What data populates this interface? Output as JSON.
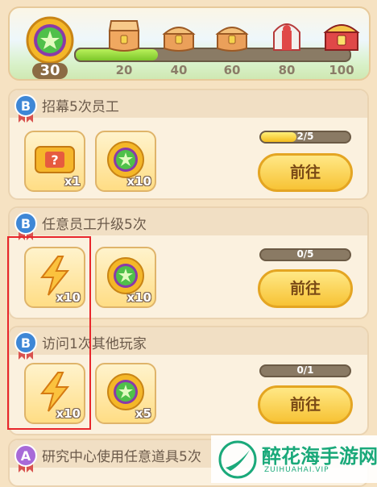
{
  "progress": {
    "current_points": "30",
    "current_value": 30,
    "max_value": 100,
    "milestones": [
      "20",
      "40",
      "60",
      "80",
      "100"
    ]
  },
  "tasks": [
    {
      "grade": "B",
      "title": "招幕5次员工",
      "rewards": [
        {
          "icon": "ticket-icon",
          "qty": "x1"
        },
        {
          "icon": "star-coin-icon",
          "qty": "x10"
        }
      ],
      "progress_text": "2/5",
      "progress_fraction": 0.4,
      "button": "前往"
    },
    {
      "grade": "B",
      "title": "任意员工升级5次",
      "rewards": [
        {
          "icon": "lightning-icon",
          "qty": "x10"
        },
        {
          "icon": "star-coin-icon",
          "qty": "x10"
        }
      ],
      "progress_text": "0/5",
      "progress_fraction": 0,
      "button": "前往"
    },
    {
      "grade": "B",
      "title": "访问1次其他玩家",
      "rewards": [
        {
          "icon": "lightning-icon",
          "qty": "x10"
        },
        {
          "icon": "star-coin-icon",
          "qty": "x5"
        }
      ],
      "progress_text": "0/1",
      "progress_fraction": 0,
      "button": "前往"
    },
    {
      "grade": "A",
      "title": "研究中心使用任意道具5次"
    }
  ],
  "watermark": {
    "title": "醉花海手游网",
    "subtitle": "ZUIHUAHAI.VIP"
  },
  "colors": {
    "accent": "#f7c335",
    "progress_fill": "#7cc62a",
    "highlight": "#e8262b",
    "watermark": "#1aa97a"
  }
}
